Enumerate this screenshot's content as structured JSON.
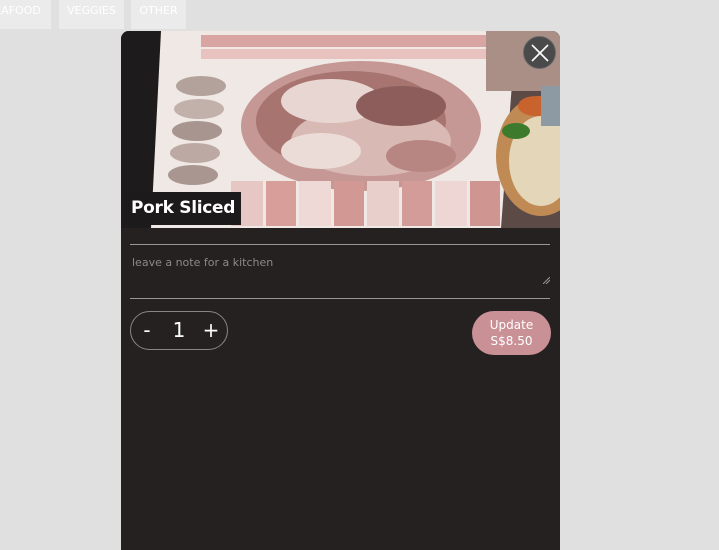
{
  "category_tabs": [
    {
      "label": "EAFOOD"
    },
    {
      "label": "VEGGIES"
    },
    {
      "label": "OTHER"
    }
  ],
  "modal": {
    "title": "Pork Sliced",
    "note_placeholder": "leave a note for a kitchen",
    "quantity": {
      "minus_label": "-",
      "value": "1",
      "plus_label": "+"
    },
    "update_button": {
      "label": "Update",
      "price": "S$8.50"
    },
    "close_icon": "close-icon"
  },
  "colors": {
    "page_background": "#e0e0e0",
    "modal_background": "#252121",
    "accent": "#c99095",
    "divider": "#9a9696"
  }
}
